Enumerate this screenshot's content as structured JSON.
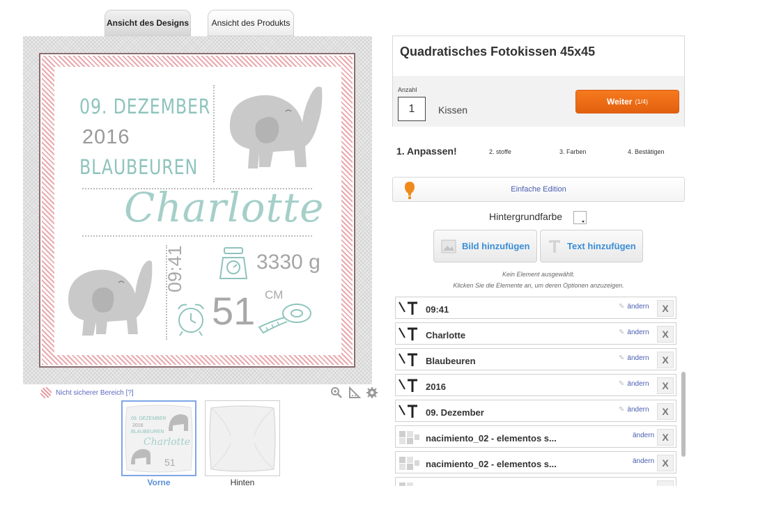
{
  "tabs": {
    "design": "Ansicht des Designs",
    "product": "Ansicht des Produkts"
  },
  "design": {
    "date": "09. DEZEMBER",
    "year": "2016",
    "city": "BLAUBEUREN",
    "name": "Charlotte",
    "time": "09:41",
    "weight": "3330 g",
    "length": "51",
    "unit": "CM"
  },
  "canvas_footer": {
    "unsafe_label": "Nicht sicherer Bereich [?]"
  },
  "thumbnails": [
    {
      "label": "Vorne"
    },
    {
      "label": "Hinten"
    }
  ],
  "product": {
    "title": "Quadratisches Fotokissen 45x45",
    "qty_label": "Anzahl",
    "qty_value": "1",
    "qty_unit": "Kissen",
    "next_label": "Weiter",
    "next_step": "(1/4)"
  },
  "steps": [
    "1. Anpassen!",
    "2. stoffe",
    "3. Farben",
    "4. Bestätigen"
  ],
  "edition": {
    "label": "Einfache Edition"
  },
  "background": {
    "label": "Hintergrundfarbe"
  },
  "actions": {
    "add_image": "Bild hinzufügen",
    "add_text": "Text hinzufügen"
  },
  "hint": {
    "line1": "Kein Element ausgewählt.",
    "line2": "Klicken Sie die Elemente an, um deren Optionen anzuzeigen."
  },
  "elements": {
    "edit_label": "ändern",
    "delete_label": "X",
    "items": [
      {
        "label": "09:41"
      },
      {
        "label": "Charlotte"
      },
      {
        "label": "Blaubeuren"
      },
      {
        "label": "2016"
      },
      {
        "label": "09. Dezember"
      },
      {
        "label": "nacimiento_02 - elementos s..."
      },
      {
        "label": "nacimiento_02 - elementos s..."
      }
    ]
  }
}
